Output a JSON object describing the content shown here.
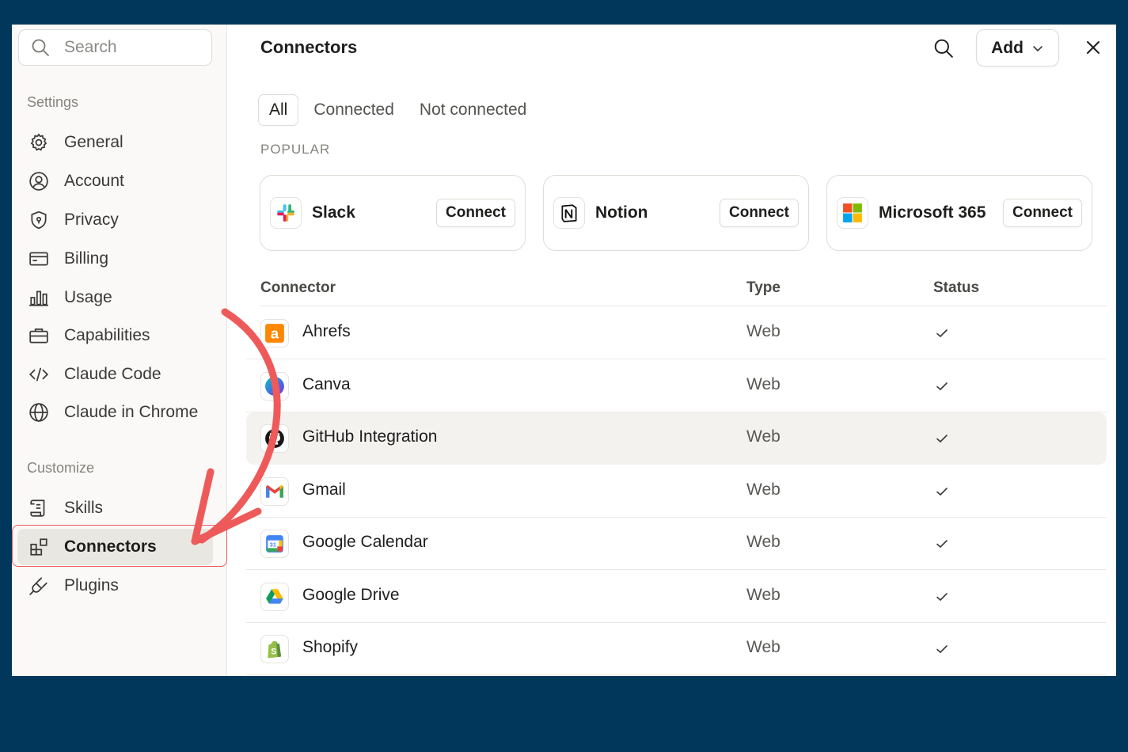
{
  "colors": {
    "background": "#00375a",
    "annotation": "#ee5a5a",
    "active_nav": "#e9e7e2"
  },
  "sidebar": {
    "search_placeholder": "Search",
    "settings_label": "Settings",
    "settings_items": [
      {
        "label": "General",
        "icon": "gear-icon"
      },
      {
        "label": "Account",
        "icon": "user-circle-icon"
      },
      {
        "label": "Privacy",
        "icon": "shield-icon"
      },
      {
        "label": "Billing",
        "icon": "credit-card-icon"
      },
      {
        "label": "Usage",
        "icon": "bar-chart-icon"
      },
      {
        "label": "Capabilities",
        "icon": "briefcase-icon"
      },
      {
        "label": "Claude Code",
        "icon": "code-icon"
      },
      {
        "label": "Claude in Chrome",
        "icon": "globe-icon"
      }
    ],
    "customize_label": "Customize",
    "customize_items": [
      {
        "label": "Skills",
        "icon": "scroll-icon"
      },
      {
        "label": "Connectors",
        "icon": "apps-icon",
        "active": true
      },
      {
        "label": "Plugins",
        "icon": "plug-icon"
      }
    ]
  },
  "main": {
    "title": "Connectors",
    "add_label": "Add",
    "tabs": [
      {
        "label": "All",
        "active": true
      },
      {
        "label": "Connected"
      },
      {
        "label": "Not connected"
      }
    ],
    "popular_label": "POPULAR",
    "popular": [
      {
        "name": "Slack",
        "button": "Connect",
        "icon": "slack-logo-icon"
      },
      {
        "name": "Notion",
        "button": "Connect",
        "icon": "notion-logo-icon"
      },
      {
        "name": "Microsoft 365",
        "button": "Connect",
        "icon": "microsoft-logo-icon"
      }
    ],
    "table": {
      "headers": {
        "connector": "Connector",
        "type": "Type",
        "status": "Status"
      },
      "rows": [
        {
          "name": "Ahrefs",
          "type": "Web",
          "status": "connected",
          "icon": "ahrefs-logo-icon"
        },
        {
          "name": "Canva",
          "type": "Web",
          "status": "connected",
          "icon": "canva-logo-icon"
        },
        {
          "name": "GitHub Integration",
          "type": "Web",
          "status": "connected",
          "icon": "github-logo-icon"
        },
        {
          "name": "Gmail",
          "type": "Web",
          "status": "connected",
          "icon": "gmail-logo-icon"
        },
        {
          "name": "Google Calendar",
          "type": "Web",
          "status": "connected",
          "icon": "google-calendar-logo-icon"
        },
        {
          "name": "Google Drive",
          "type": "Web",
          "status": "connected",
          "icon": "google-drive-logo-icon"
        },
        {
          "name": "Shopify",
          "type": "Web",
          "status": "connected",
          "icon": "shopify-logo-icon"
        }
      ]
    }
  }
}
